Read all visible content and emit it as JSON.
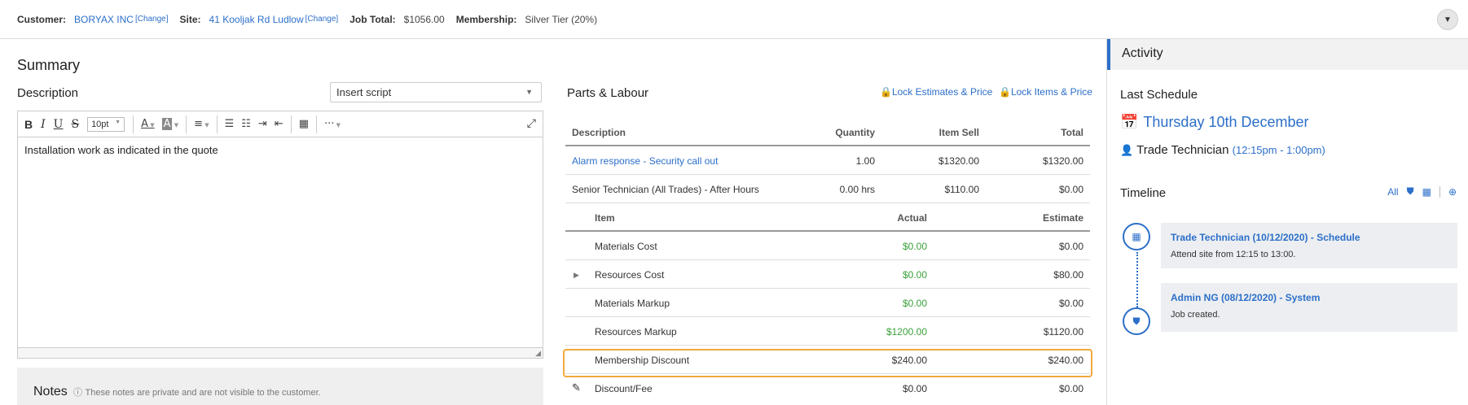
{
  "topbar": {
    "customer_label": "Customer:",
    "customer_value": "BORYAX INC",
    "customer_change": "[Change]",
    "site_label": "Site:",
    "site_value": "41 Kooljak Rd Ludlow",
    "site_change": "[Change]",
    "job_total_label": "Job Total:",
    "job_total_value": "$1056.00",
    "membership_label": "Membership:",
    "membership_value": "Silver Tier (20%)"
  },
  "summary": {
    "title": "Summary",
    "description_label": "Description",
    "insert_script": "Insert script",
    "font_size": "10pt",
    "editor_text": "Installation work as indicated in the quote",
    "notes_title": "Notes",
    "notes_sub": "These notes are private and are not visible to the customer."
  },
  "parts": {
    "title": "Parts & Labour",
    "lock_estimates": "Lock Estimates & Price",
    "lock_items": "Lock Items & Price",
    "headers": [
      "Description",
      "Quantity",
      "Item Sell",
      "Total"
    ],
    "rows": [
      {
        "description": "Alarm response - Security call out",
        "quantity": "1.00",
        "item_sell": "$1320.00",
        "total": "$1320.00"
      },
      {
        "description": "Senior Technician (All Trades) - After Hours",
        "quantity": "0.00 hrs",
        "item_sell": "$110.00",
        "total": "$0.00"
      }
    ],
    "sub_headers": [
      "Item",
      "Actual",
      "Estimate"
    ],
    "sub_rows": [
      {
        "item": "Materials Cost",
        "actual": "$0.00",
        "estimate": "$0.00"
      },
      {
        "item": "Resources Cost",
        "actual": "$0.00",
        "estimate": "$80.00"
      },
      {
        "item": "Materials Markup",
        "actual": "$0.00",
        "estimate": "$0.00"
      },
      {
        "item": "Resources Markup",
        "actual": "$1200.00",
        "estimate": "$1120.00"
      },
      {
        "item": "Membership Discount",
        "actual": "$240.00",
        "estimate": "$240.00"
      },
      {
        "item": "Discount/Fee",
        "actual": "$0.00",
        "estimate": "$0.00"
      }
    ]
  },
  "activity": {
    "title": "Activity",
    "last_schedule_label": "Last Schedule",
    "schedule_date": "Thursday 10th December",
    "schedule_tech": "Trade Technician",
    "schedule_time": "(12:15pm - 1:00pm)",
    "timeline_label": "Timeline",
    "timeline_all": "All",
    "timeline": [
      {
        "title": "Trade Technician (10/12/2020) - Schedule",
        "detail": "Attend site from 12:15 to 13:00.",
        "icon": "calendar-icon"
      },
      {
        "title": "Admin NG (08/12/2020) - System",
        "detail": "Job created.",
        "icon": "shield-icon"
      }
    ]
  },
  "colors": {
    "accent": "#2c6fc9",
    "highlight": "#f2a93b",
    "green": "#3aa13a"
  }
}
